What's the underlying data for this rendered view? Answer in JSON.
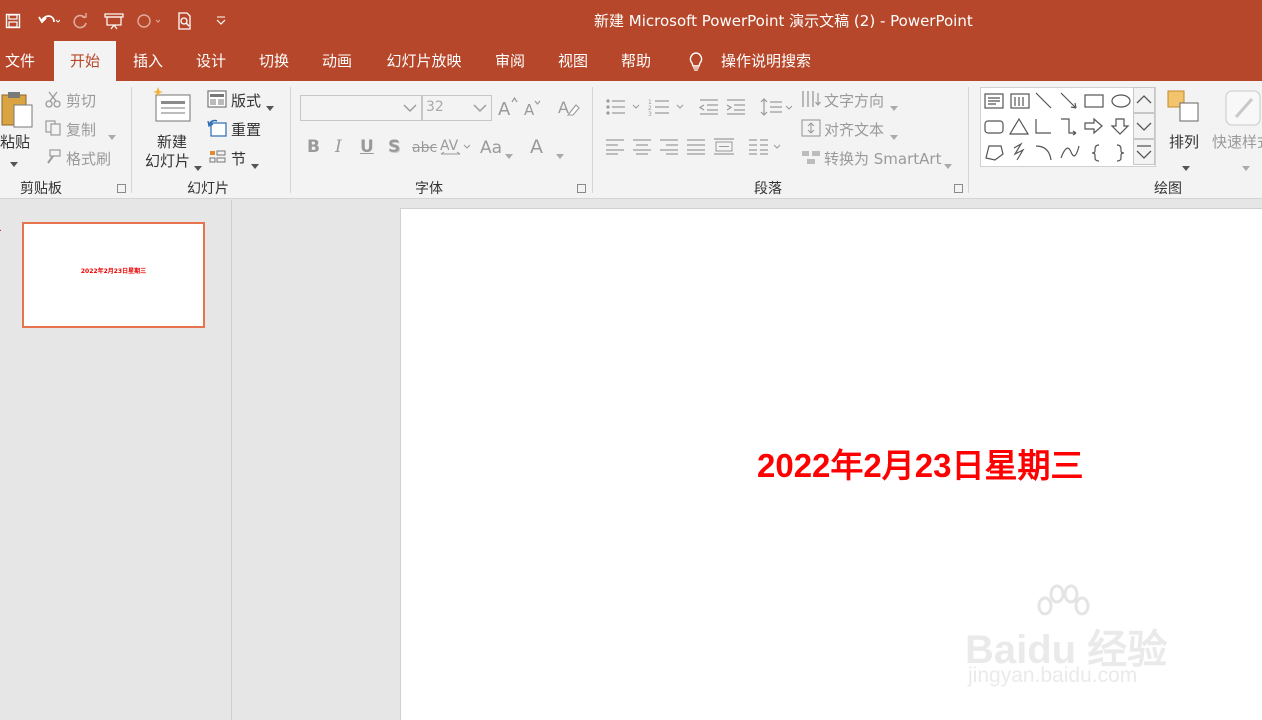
{
  "window": {
    "title": "新建 Microsoft PowerPoint 演示文稿 (2)  -  PowerPoint"
  },
  "tabs": [
    "文件",
    "开始",
    "插入",
    "设计",
    "切换",
    "动画",
    "幻灯片放映",
    "审阅",
    "视图",
    "帮助",
    "操作说明搜索"
  ],
  "active_tab": "开始",
  "clipboard": {
    "paste": "粘贴",
    "cut": "剪切",
    "copy": "复制",
    "format_painter": "格式刷",
    "group": "剪贴板"
  },
  "slides": {
    "new_slide_1": "新建",
    "new_slide_2": "幻灯片",
    "layout": "版式",
    "reset": "重置",
    "section": "节",
    "group": "幻灯片"
  },
  "font": {
    "font_name": "",
    "font_size": "32",
    "bold": "B",
    "italic": "I",
    "underline": "U",
    "shadow": "S",
    "strike": "abc",
    "case": "Aa",
    "color": "A",
    "group": "字体"
  },
  "paragraph": {
    "text_direction": "文字方向",
    "align_text": "对齐文本",
    "smartart": "转换为 SmartArt",
    "group": "段落"
  },
  "drawing": {
    "arrange": "排列",
    "quick_styles": "快速样式",
    "group": "绘图"
  },
  "thumbnail": {
    "number": "1",
    "text": "2022年2月23日星期三"
  },
  "slide_content": {
    "text": "2022年2月23日星期三"
  },
  "watermark": {
    "brand": "Baidu 经验",
    "url": "jingyan.baidu.com"
  },
  "colors": {
    "accent": "#b7472a",
    "slide_text": "#ff0000",
    "thumb_border": "#e8734f"
  }
}
